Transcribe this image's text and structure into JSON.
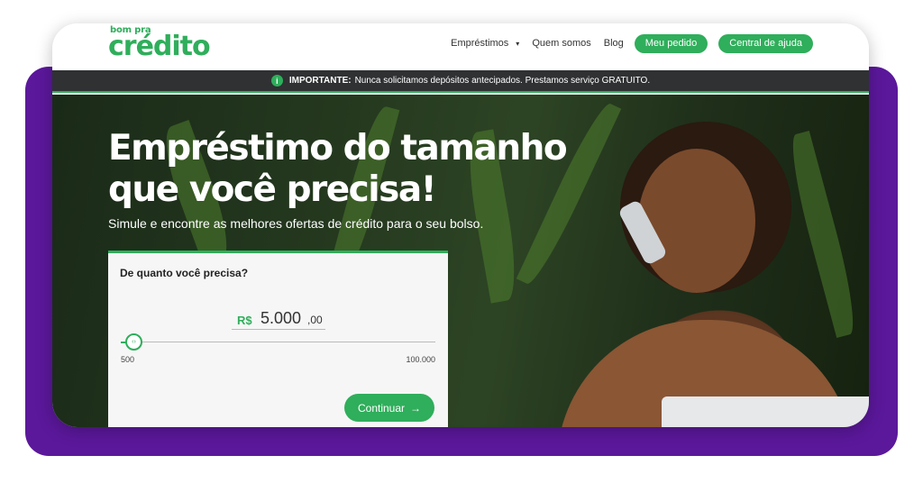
{
  "logo": {
    "small": "bom pra",
    "main": "crédito"
  },
  "nav": {
    "items": [
      {
        "label": "Empréstimos",
        "has_dropdown": true
      },
      {
        "label": "Quem somos"
      },
      {
        "label": "Blog"
      }
    ],
    "buttons": [
      "Meu pedido",
      "Central de ajuda"
    ],
    "chevron": "▾"
  },
  "notice": {
    "icon": "i",
    "bold": "IMPORTANTE:",
    "text": "Nunca solicitamos depósitos antecipados. Prestamos serviço GRATUITO."
  },
  "hero": {
    "title_line1": "Empréstimo do tamanho",
    "title_line2": "que você precisa!",
    "subtitle": "Simule e encontre as melhores ofertas de crédito para o seu bolso."
  },
  "simulator": {
    "label": "De quanto você precisa?",
    "currency": "R$",
    "amount": "5.000",
    "cents": ",00",
    "knob_glyph": "‹›",
    "min_label": "500",
    "max_label": "100.000",
    "slider_value": 5000,
    "continue_label": "Continuar",
    "continue_arrow": "→"
  },
  "colors": {
    "brand_green": "#2fae5b",
    "purple": "#5b189b",
    "notice_bg": "#2f3133"
  }
}
